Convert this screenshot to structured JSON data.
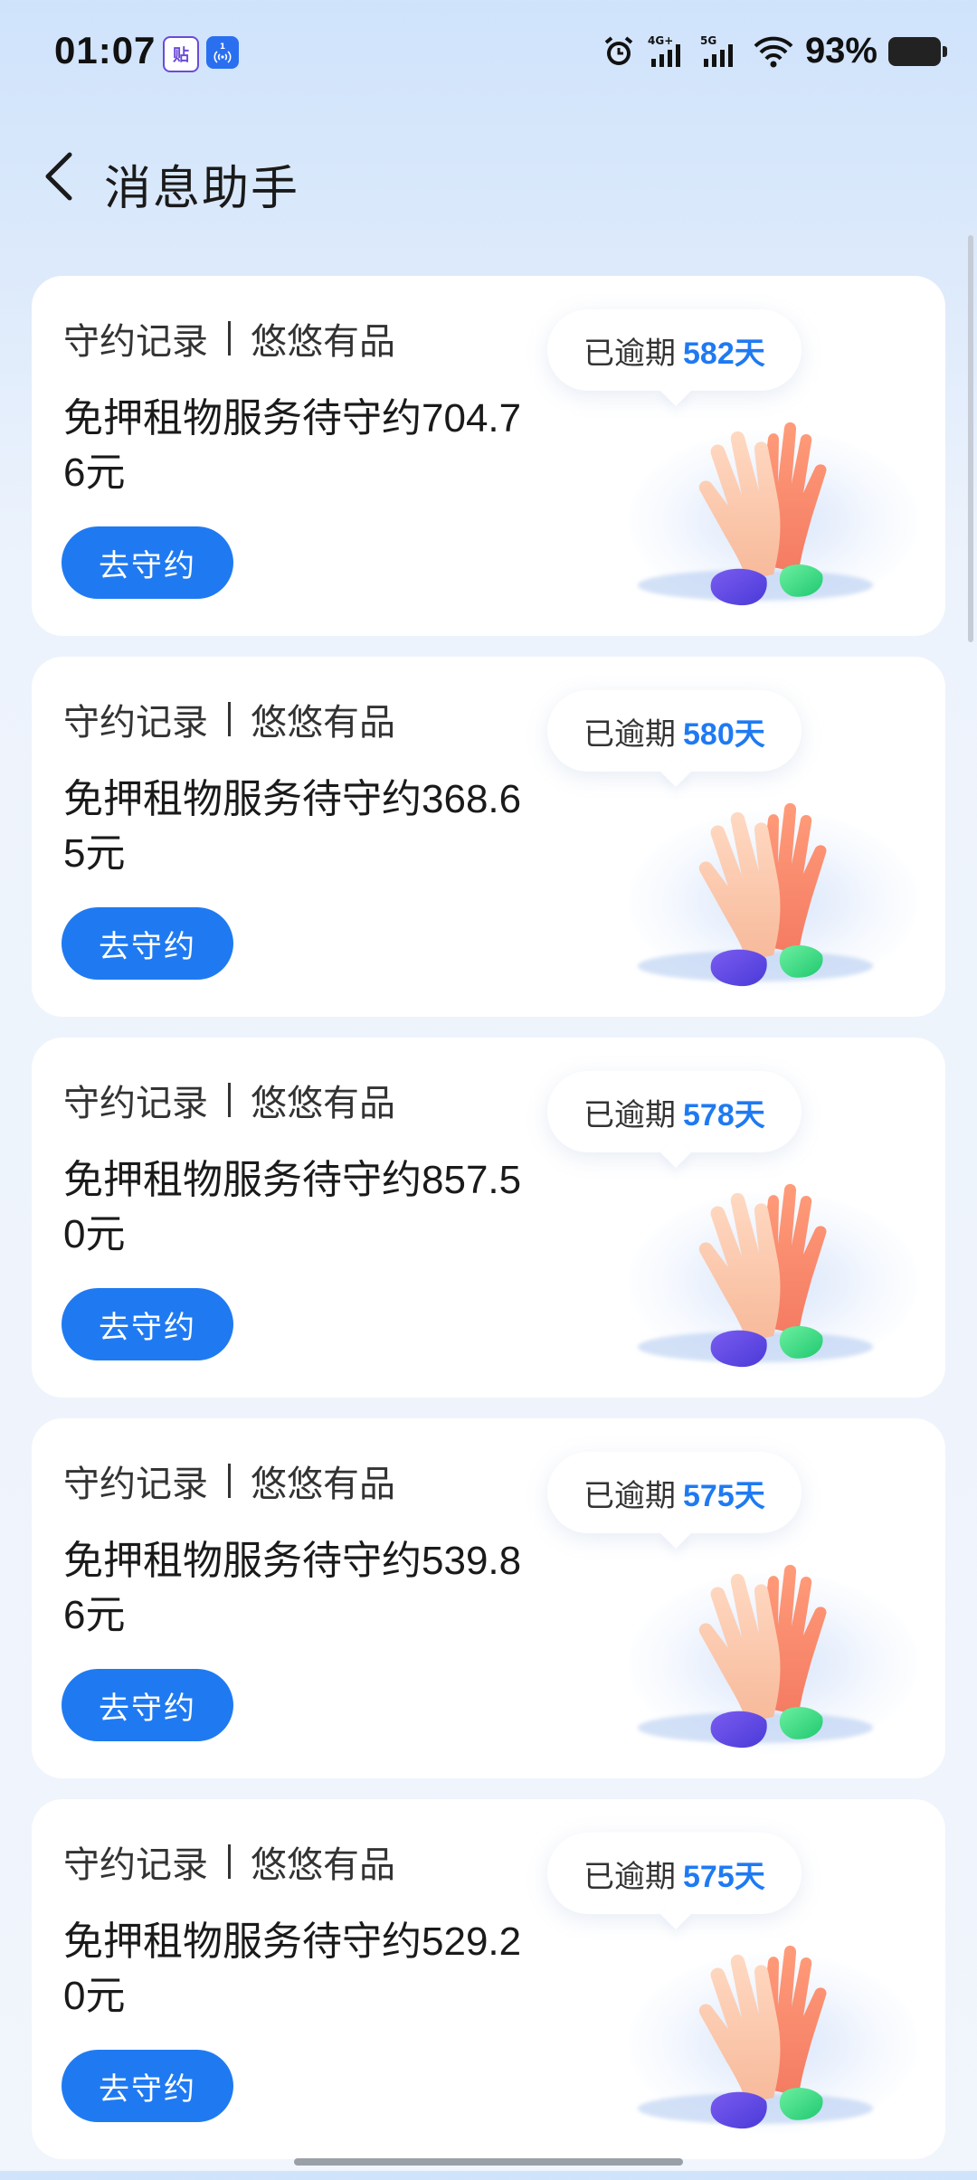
{
  "status_bar": {
    "time": "01:07",
    "notif_icons": [
      "贴",
      "1"
    ],
    "network_1": "4G+",
    "network_2": "5G",
    "battery": "93%"
  },
  "header": {
    "title": "消息助手"
  },
  "cards": [
    {
      "category": "守约记录",
      "merchant": "悠悠有品",
      "message": "免押租物服务待守约704.76元",
      "action": "去守约",
      "overdue_label": "已逾期",
      "overdue_days": "582天"
    },
    {
      "category": "守约记录",
      "merchant": "悠悠有品",
      "message": "免押租物服务待守约368.65元",
      "action": "去守约",
      "overdue_label": "已逾期",
      "overdue_days": "580天"
    },
    {
      "category": "守约记录",
      "merchant": "悠悠有品",
      "message": "免押租物服务待守约857.50元",
      "action": "去守约",
      "overdue_label": "已逾期",
      "overdue_days": "578天"
    },
    {
      "category": "守约记录",
      "merchant": "悠悠有品",
      "message": "免押租物服务待守约539.86元",
      "action": "去守约",
      "overdue_label": "已逾期",
      "overdue_days": "575天"
    },
    {
      "category": "守约记录",
      "merchant": "悠悠有品",
      "message": "免押租物服务待守约529.20元",
      "action": "去守约",
      "overdue_label": "已逾期",
      "overdue_days": "575天"
    }
  ],
  "colors": {
    "accent": "#1f7af2",
    "background_top": "#cfe3fb",
    "card": "#ffffff"
  },
  "icons": {
    "back": "chevron-left-icon",
    "illustration": "high-five-hands-icon"
  }
}
